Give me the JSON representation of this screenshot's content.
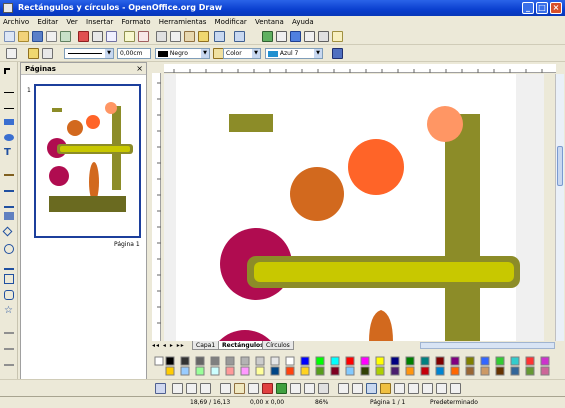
{
  "window": {
    "title": "Rectángulos y círculos - OpenOffice.org Draw"
  },
  "menu": [
    "Archivo",
    "Editar",
    "Ver",
    "Insertar",
    "Formato",
    "Herramientas",
    "Modificar",
    "Ventana",
    "Ayuda"
  ],
  "line_toolbar": {
    "line_width": "0,00cm",
    "line_color": "Negro",
    "fill_type": "Color",
    "fill_color": "Azul 7"
  },
  "pages_panel": {
    "title": "Páginas",
    "page_number": "1",
    "page_label": "Página 1"
  },
  "layer_tabs": [
    {
      "label": "Capa1",
      "active": false
    },
    {
      "label": "Rectángulos",
      "active": true
    },
    {
      "label": "Círculos",
      "active": false
    }
  ],
  "status": {
    "position": "18,69 / 16,13",
    "size": "0,00 x 0,00",
    "zoom": "86%",
    "page": "Página 1 / 1",
    "style": "Predeterminado"
  },
  "colors": {
    "olive": "#8C8C28",
    "yellow": "#C8C800",
    "crimson": "#B00C50",
    "orange": "#FF6428",
    "salmon": "#FF9664",
    "rust": "#D2691E",
    "palette": [
      "#000000",
      "#333333",
      "#666666",
      "#808080",
      "#999999",
      "#b3b3b3",
      "#cccccc",
      "#e6e6e6",
      "#ffffff",
      "#0000ff",
      "#00ff00",
      "#00ffff",
      "#ff0000",
      "#ff00ff",
      "#ffff00",
      "#000080",
      "#008000",
      "#008080",
      "#800000",
      "#800080",
      "#808000",
      "#3366ff",
      "#33cc33",
      "#33cccc",
      "#ff3333",
      "#cc33cc",
      "#ffcc00",
      "#99ccff",
      "#99ff99",
      "#ccffff",
      "#ff9999",
      "#ff99ff",
      "#ffff99",
      "#004586",
      "#ff420e",
      "#ffd320",
      "#579d1c",
      "#7e0021",
      "#83caff",
      "#314004",
      "#aecf00",
      "#4b1f6f",
      "#ff950e",
      "#c5000b",
      "#0084d1",
      "#ff6600",
      "#996633",
      "#cc9966",
      "#663300",
      "#336699",
      "#669933",
      "#cc6699"
    ]
  }
}
